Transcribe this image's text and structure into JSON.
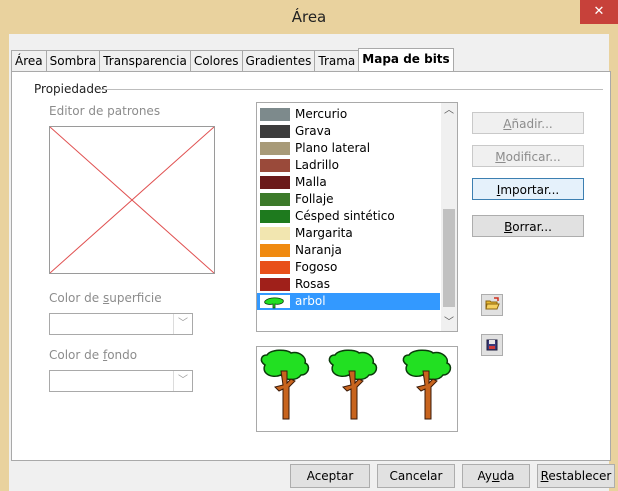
{
  "window": {
    "title": "Área",
    "close_glyph": "✕"
  },
  "tabs": [
    {
      "label": "Área",
      "active": false
    },
    {
      "label": "Sombra",
      "active": false
    },
    {
      "label": "Transparencia",
      "active": false
    },
    {
      "label": "Colores",
      "active": false
    },
    {
      "label": "Gradientes",
      "active": false
    },
    {
      "label": "Trama",
      "active": false
    },
    {
      "label": "Mapa de bits",
      "active": true
    }
  ],
  "properties": {
    "section_label": "Propiedades",
    "pattern_editor_label": "Editor de patrones",
    "surface_color_label": {
      "before": "Color de ",
      "access": "s",
      "after": "uperficie"
    },
    "surface_color_value": "",
    "background_color_label": {
      "before": "Color de ",
      "access": "f",
      "after": "ondo"
    },
    "background_color_value": ""
  },
  "bitmaps": {
    "items": [
      {
        "label": "Mercurio",
        "swatch": "#7d8a8c"
      },
      {
        "label": "Grava",
        "swatch": "#3c3c3c"
      },
      {
        "label": "Plano lateral",
        "swatch": "#a89a78"
      },
      {
        "label": "Ladrillo",
        "swatch": "#9a4a3a"
      },
      {
        "label": "Malla",
        "swatch": "#6b1a1a"
      },
      {
        "label": "Follaje",
        "swatch": "#3c7a2a"
      },
      {
        "label": "Césped sintético",
        "swatch": "#1e7a1e"
      },
      {
        "label": "Margarita",
        "swatch": "#f2e6b0"
      },
      {
        "label": "Naranja",
        "swatch": "#f08a10"
      },
      {
        "label": "Fogoso",
        "swatch": "#e8501a"
      },
      {
        "label": "Rosas",
        "swatch": "#a0201a"
      },
      {
        "label": "arbol",
        "swatch": "#ffffff",
        "selected": true
      }
    ],
    "selected": "arbol"
  },
  "buttons": {
    "add": {
      "before": "",
      "access": "A",
      "after": "ñadir..."
    },
    "modify": {
      "before": "",
      "access": "M",
      "after": "odificar..."
    },
    "import": {
      "before": "",
      "access": "I",
      "after": "mportar..."
    },
    "delete": {
      "before": "",
      "access": "B",
      "after": "orrar..."
    }
  },
  "footer": {
    "ok": "Aceptar",
    "cancel": "Cancelar",
    "help": {
      "before": "Ay",
      "access": "u",
      "after": "da"
    },
    "reset": {
      "before": "",
      "access": "R",
      "after": "establecer"
    }
  },
  "icons": {
    "load": "open-folder-icon",
    "save": "save-disk-icon"
  },
  "colors": {
    "title_bar": "#e9d29e",
    "close": "#c7413a",
    "selection": "#3399ff",
    "tree_leaves": "#22e022",
    "tree_trunk": "#c8641e"
  }
}
